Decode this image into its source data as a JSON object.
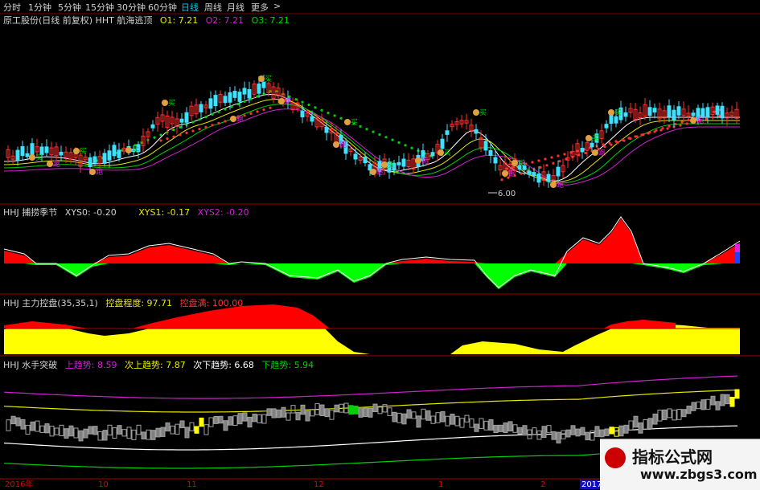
{
  "toolbar": {
    "periods": [
      "分时",
      "1分钟",
      "5分钟",
      "15分钟",
      "30分钟",
      "60分钟",
      "日线",
      "周线",
      "月线",
      "更多"
    ],
    "active_period": "日线",
    "more_arrow": ">"
  },
  "main_chart": {
    "title": "原工股份(日线 前复权) HHT 航海逃顶",
    "o1_label": "O1: 7.21",
    "o2_label": "O2: 7.21",
    "o3_label": "O3: 7.21",
    "low_price_label": "6.00",
    "marker_rise": "买",
    "marker_fall": "跑"
  },
  "panel_xys": {
    "title": "HHJ 捕捞季节",
    "xys0": "XYS0: -0.20",
    "xys1": "XYS1: -0.17",
    "xys2": "XYS2: -0.20"
  },
  "panel_control": {
    "title": "HHJ 主力控盘(35,35,1)",
    "degree": "控盘程度: 97.71",
    "full": "控盘满: 100.00"
  },
  "panel_trend": {
    "title": "HHJ 水手突破",
    "up": "上趋势: 8.59",
    "sub_up": "次上趋势: 7.87",
    "sub_down": "次下趋势: 6.68",
    "down": "下趋势: 5.94"
  },
  "xaxis": {
    "labels": [
      "2016年",
      "10",
      "11",
      "12",
      "1",
      "2",
      "2017"
    ]
  },
  "watermark": {
    "line1": "指标公式网",
    "line2": "www.zbgs3.com"
  },
  "colors": {
    "up": "#ff3030",
    "down": "#40e0ff",
    "ma_yellow": "#e8e800",
    "ma_white": "#ffffff",
    "ma_green": "#00d000",
    "ma_purple": "#d020d0",
    "fill_red": "#ff0000",
    "fill_green": "#00ff00",
    "fill_yellow": "#ffff00",
    "separator": "#a00000"
  }
}
